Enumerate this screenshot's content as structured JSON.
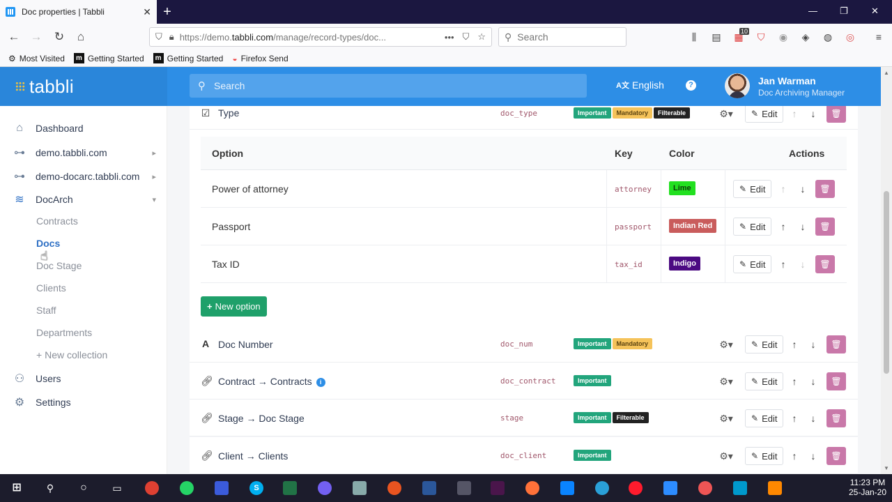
{
  "browser": {
    "tab_title": "Doc properties | Tabbli",
    "tab_close": "✕",
    "new_tab": "+",
    "url_domain": "https://demo.",
    "url_host": "tabbli.com",
    "url_path": "/manage/record-types/doc...",
    "search_placeholder": "Search",
    "toolbar_badge": "10",
    "bookmarks": [
      {
        "label": "Most Visited",
        "icon": "gear-icon"
      },
      {
        "label": "Getting Started",
        "icon": "m-logo-icon"
      },
      {
        "label": "Getting Started",
        "icon": "m-logo-icon"
      },
      {
        "label": "Firefox Send",
        "icon": "send-icon"
      }
    ]
  },
  "app": {
    "logo": "tabbli",
    "search_placeholder": "Search",
    "language": "English",
    "language_icon": "translate-icon",
    "user_name": "Jan Warman",
    "user_role": "Doc Archiving Manager"
  },
  "sidebar": {
    "items": [
      {
        "label": "Dashboard",
        "icon": "home-icon"
      },
      {
        "label": "demo.tabbli.com",
        "icon": "sitemap-icon"
      },
      {
        "label": "demo-docarc.tabbli.com",
        "icon": "sitemap-icon"
      },
      {
        "label": "DocArch",
        "icon": "database-icon"
      }
    ],
    "sub_items": [
      "Contracts",
      "Docs",
      "Doc Stage",
      "Clients",
      "Staff",
      "Departments",
      "New collection"
    ],
    "bottom_items": [
      {
        "label": "Users",
        "icon": "users-icon"
      },
      {
        "label": "Settings",
        "icon": "gear-icon"
      }
    ]
  },
  "main": {
    "type_field": {
      "label": "Type",
      "key": "doc_type",
      "badges": [
        "Important",
        "Mandatory",
        "Filterable"
      ]
    },
    "options_table": {
      "headers": {
        "option": "Option",
        "key": "Key",
        "color": "Color",
        "actions": "Actions"
      },
      "rows": [
        {
          "name": "Power of attorney",
          "key": "attorney",
          "color_name": "Lime",
          "color_bg": "#22e020",
          "color_fg": "#0c3a0a"
        },
        {
          "name": "Passport",
          "key": "passport",
          "color_name": "Indian Red",
          "color_bg": "#c95c5c",
          "color_fg": "#ffffff"
        },
        {
          "name": "Tax ID",
          "key": "tax_id",
          "color_name": "Indigo",
          "color_bg": "#4b0a82",
          "color_fg": "#ffffff"
        }
      ]
    },
    "new_option_label": "New option",
    "edit_label": "Edit",
    "fields": [
      {
        "label": "Doc Number",
        "icon": "text-a-icon",
        "key": "doc_num",
        "badges": [
          "Important",
          "Mandatory"
        ]
      },
      {
        "label": "Contract",
        "target": "Contracts",
        "icon": "link-icon",
        "key": "doc_contract",
        "badges": [
          "Important"
        ],
        "info": "i"
      },
      {
        "label": "Stage",
        "target": "Doc Stage",
        "icon": "link-icon",
        "key": "stage",
        "badges": [
          "Important",
          "Filterable"
        ]
      },
      {
        "label": "Client",
        "target": "Clients",
        "icon": "link-icon",
        "key": "doc_client",
        "badges": [
          "Important"
        ]
      }
    ]
  },
  "taskbar": {
    "time": "11:23 PM",
    "date": "25-Jan-20"
  },
  "colors": {
    "header_blue": "#2d8ee6",
    "important": "#22a57c",
    "mandatory": "#f5c35a",
    "filterable": "#222222",
    "delete": "#c978a9",
    "new_option": "#1fa06a"
  }
}
